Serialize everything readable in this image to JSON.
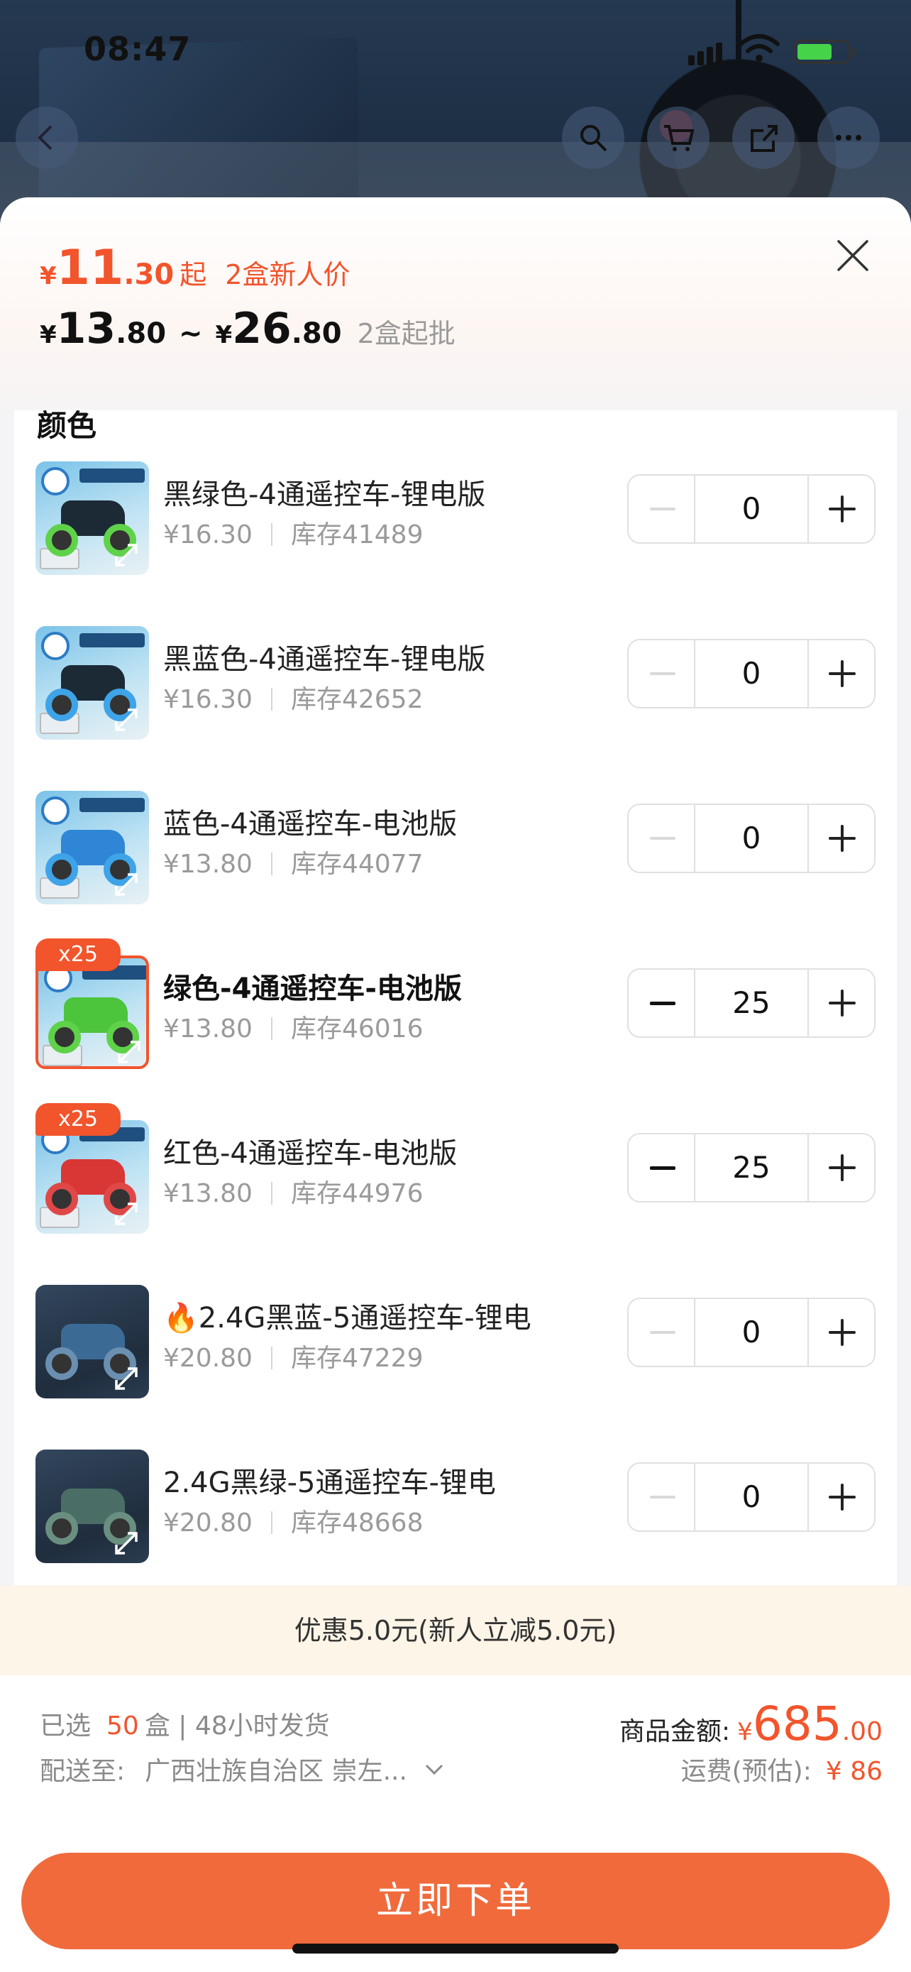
{
  "status_bar": {
    "time": "08:47"
  },
  "header": {
    "new_price": {
      "currency": "¥",
      "int": "11",
      "dec": ".30",
      "suffix": "起",
      "promo": "2盒新人价"
    },
    "range": {
      "currency": "¥",
      "min_int": "13",
      "min_dec": ".80",
      "tilde": "~",
      "max_int": "26",
      "max_dec": ".80",
      "moq": "2盒起批"
    }
  },
  "section_title": "颜色",
  "items": [
    {
      "name": "黑绿色-4通遥控车-锂电版",
      "price": "¥16.30",
      "stock": "库存41489",
      "qty": "0",
      "badge": "",
      "selected": false,
      "theme": "light",
      "body": "#1c2a36",
      "wheel": "#5fd24a"
    },
    {
      "name": "黑蓝色-4通遥控车-锂电版",
      "price": "¥16.30",
      "stock": "库存42652",
      "qty": "0",
      "badge": "",
      "selected": false,
      "theme": "light",
      "body": "#1c2a36",
      "wheel": "#3fa3e8"
    },
    {
      "name": "蓝色-4通遥控车-电池版",
      "price": "¥13.80",
      "stock": "库存44077",
      "qty": "0",
      "badge": "",
      "selected": false,
      "theme": "light",
      "body": "#2f86d6",
      "wheel": "#3fa3e8"
    },
    {
      "name": "绿色-4通遥控车-电池版",
      "price": "¥13.80",
      "stock": "库存46016",
      "qty": "25",
      "badge": "x25",
      "selected": true,
      "theme": "light",
      "body": "#4cc43c",
      "wheel": "#5fd24a"
    },
    {
      "name": "红色-4通遥控车-电池版",
      "price": "¥13.80",
      "stock": "库存44976",
      "qty": "25",
      "badge": "x25",
      "selected": false,
      "theme": "light",
      "body": "#d93636",
      "wheel": "#e04848"
    },
    {
      "name": "🔥2.4G黑蓝-5通遥控车-锂电",
      "price": "¥20.80",
      "stock": "库存47229",
      "qty": "0",
      "badge": "",
      "selected": false,
      "theme": "dark",
      "body": "#3b6b95",
      "wheel": "#6a8fb0"
    },
    {
      "name": "2.4G黑绿-5通遥控车-锂电",
      "price": "¥20.80",
      "stock": "库存48668",
      "qty": "0",
      "badge": "",
      "selected": false,
      "theme": "dark",
      "body": "#4a6e66",
      "wheel": "#6a8f80"
    }
  ],
  "discount_bar": "优惠5.0元(新人立减5.0元)",
  "footer": {
    "selected_label": "已选",
    "selected_count": "50",
    "selected_unit": "盒 | 48小时发货",
    "ship_label": "配送至:",
    "ship_address": "广西壮族自治区 崇左...",
    "amount_label": "商品金额:",
    "amount_currency": "¥",
    "amount_int": "685",
    "amount_dec": ".00",
    "freight_label": "运费(预估):",
    "freight_value": "¥ 86",
    "order_button": "立即下单"
  },
  "colors": {
    "accent": "#f2542c",
    "button": "#f06a3c",
    "discount_bg": "#fdf5e7"
  }
}
